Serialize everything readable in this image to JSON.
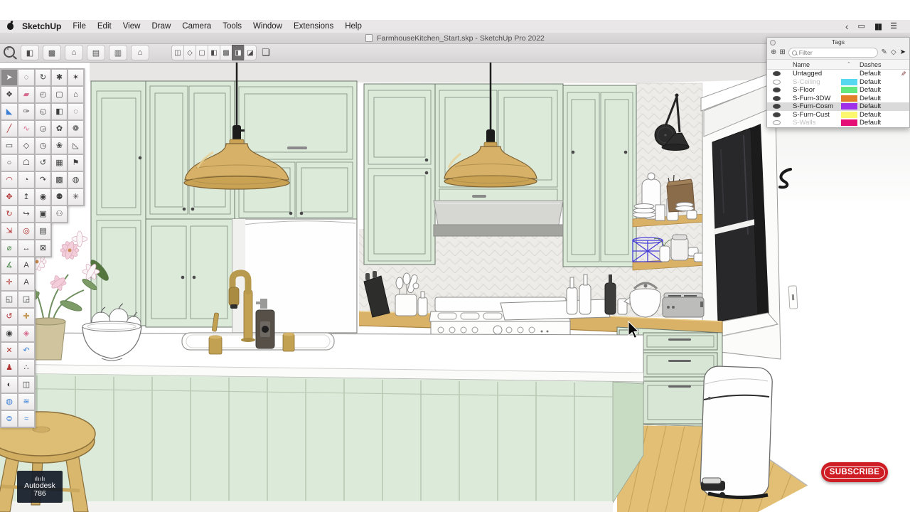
{
  "title_bar": {
    "title": "FarmhouseKitchen_Start.skp - SketchUp Pro 2022"
  },
  "menu_bar": {
    "items": [
      "SketchUp",
      "File",
      "Edit",
      "View",
      "Draw",
      "Camera",
      "Tools",
      "Window",
      "Extensions",
      "Help"
    ],
    "status_icons": [
      {
        "name": "back-chevron-icon",
        "glyph": "‹"
      },
      {
        "name": "display-mirror-icon",
        "glyph": "▭"
      },
      {
        "name": "app-switcher-icon",
        "glyph": "▮▮"
      },
      {
        "name": "list-icon",
        "glyph": "☰"
      }
    ]
  },
  "toolbar": {
    "zoom_tool_name": "zoom-selection",
    "view_buttons": [
      {
        "name": "iso-view",
        "glyph": "◧"
      },
      {
        "name": "textured-view",
        "glyph": "▩"
      },
      {
        "name": "home-view",
        "glyph": "⌂"
      },
      {
        "name": "front-view",
        "glyph": "▤"
      },
      {
        "name": "saved-view",
        "glyph": "▥"
      },
      {
        "name": "outline-view",
        "glyph": "⌂"
      }
    ],
    "style_buttons": [
      {
        "name": "x-ray-style",
        "glyph": "◫"
      },
      {
        "name": "wireframe-style",
        "glyph": "◇"
      },
      {
        "name": "hidden-line-style",
        "glyph": "▢"
      },
      {
        "name": "shaded-style",
        "glyph": "◧"
      },
      {
        "name": "shaded-textures-style",
        "glyph": "▩"
      },
      {
        "name": "sketchy-edges-style",
        "glyph": "◨",
        "selected": true
      },
      {
        "name": "monochrome-style",
        "glyph": "◪"
      }
    ],
    "book_button": {
      "name": "styles-book",
      "glyph": "❏"
    }
  },
  "left_palette": {
    "main": [
      {
        "name": "select",
        "glyph": "➤",
        "selected": true
      },
      {
        "name": "lasso",
        "glyph": "◌"
      },
      {
        "name": "make-component",
        "glyph": "❖"
      },
      {
        "name": "eraser",
        "glyph": "▰",
        "color": "#d66a8e"
      },
      {
        "name": "paint-bucket",
        "glyph": "◣",
        "color": "#3b7fd4"
      },
      {
        "name": "sample-material",
        "glyph": "✑"
      },
      {
        "name": "line",
        "glyph": "╱",
        "color": "#b03030"
      },
      {
        "name": "freehand",
        "glyph": "∿",
        "color": "#d66a8e"
      },
      {
        "name": "rectangle",
        "glyph": "▭"
      },
      {
        "name": "rotated-rectangle",
        "glyph": "◇"
      },
      {
        "name": "circle",
        "glyph": "○"
      },
      {
        "name": "polygon",
        "glyph": "☖"
      },
      {
        "name": "arc",
        "glyph": "◠",
        "color": "#b03030"
      },
      {
        "name": "pie",
        "glyph": "◔"
      },
      {
        "name": "move",
        "glyph": "✥",
        "color": "#b03030"
      },
      {
        "name": "push-pull",
        "glyph": "↥"
      },
      {
        "name": "rotate",
        "glyph": "↻",
        "color": "#b03030"
      },
      {
        "name": "follow-me",
        "glyph": "↪"
      },
      {
        "name": "scale",
        "glyph": "⇲",
        "color": "#b03030"
      },
      {
        "name": "offset",
        "glyph": "◎",
        "color": "#b03030"
      },
      {
        "name": "tape-measure",
        "glyph": "⌀",
        "color": "#3f7f3f"
      },
      {
        "name": "dimension",
        "glyph": "↔"
      },
      {
        "name": "protractor",
        "glyph": "∡",
        "color": "#3f7f3f"
      },
      {
        "name": "text",
        "glyph": "A"
      },
      {
        "name": "axes",
        "glyph": "✛",
        "color": "#b03030"
      },
      {
        "name": "3d-text",
        "glyph": "A"
      },
      {
        "name": "section-plane",
        "glyph": "◱"
      },
      {
        "name": "section-fill",
        "glyph": "◲"
      },
      {
        "name": "orbit",
        "glyph": "↺",
        "color": "#b03030"
      },
      {
        "name": "pan",
        "glyph": "✚",
        "color": "#c59a56"
      },
      {
        "name": "zoom",
        "glyph": "◉"
      },
      {
        "name": "zoom-window",
        "glyph": "◈",
        "color": "#d66a8e"
      },
      {
        "name": "zoom-extents",
        "glyph": "✕",
        "color": "#b03030"
      },
      {
        "name": "previous-view",
        "glyph": "↶",
        "color": "#3b7fd4"
      },
      {
        "name": "position-camera",
        "glyph": "♟",
        "color": "#b03030"
      },
      {
        "name": "walk",
        "glyph": "∴"
      },
      {
        "name": "look-around",
        "glyph": "◐"
      },
      {
        "name": "section-display",
        "glyph": "◫"
      },
      {
        "name": "sandbox-smoove",
        "glyph": "◍",
        "color": "#3b7fd4"
      },
      {
        "name": "sandbox-drape",
        "glyph": "≋",
        "color": "#3b7fd4"
      },
      {
        "name": "sandbox-stamp",
        "glyph": "⊜",
        "color": "#3b7fd4"
      },
      {
        "name": "sandbox-detail",
        "glyph": "≈",
        "color": "#3b7fd4"
      }
    ],
    "aux_a": [
      {
        "name": "rotate-view",
        "glyph": "↻"
      },
      {
        "name": "iso-view-tool",
        "glyph": "◴"
      },
      {
        "name": "top-view-tool",
        "glyph": "◵"
      },
      {
        "name": "front-view-tool",
        "glyph": "◶"
      },
      {
        "name": "back-view-tool",
        "glyph": "◷"
      },
      {
        "name": "left-view-tool",
        "glyph": "↺"
      },
      {
        "name": "right-view-tool",
        "glyph": "↷"
      },
      {
        "name": "camera-eye-tool",
        "glyph": "◉"
      },
      {
        "name": "frame-tool",
        "glyph": "▣"
      },
      {
        "name": "panels-tool",
        "glyph": "▤"
      },
      {
        "name": "lock-tool",
        "glyph": "⊠"
      }
    ],
    "aux_b": [
      {
        "name": "settings-tool",
        "glyph": "✱"
      },
      {
        "name": "box-tool",
        "glyph": "▢"
      },
      {
        "name": "camera-box-tool",
        "glyph": "◧"
      },
      {
        "name": "leaf-tool",
        "glyph": "✿"
      },
      {
        "name": "plant-tool",
        "glyph": "❀"
      },
      {
        "name": "tiles-tool",
        "glyph": "▦"
      },
      {
        "name": "grid-tool",
        "glyph": "▩"
      },
      {
        "name": "figures-tool",
        "glyph": "⚉"
      },
      {
        "name": "figure-pair-tool",
        "glyph": "⚇"
      }
    ],
    "aux_c": [
      {
        "name": "gear-tool",
        "glyph": "✶"
      },
      {
        "name": "roof-tool",
        "glyph": "⌂"
      },
      {
        "name": "ring-tool",
        "glyph": "◌"
      },
      {
        "name": "flower-tool",
        "glyph": "❁"
      },
      {
        "name": "ramp-tool",
        "glyph": "◺"
      },
      {
        "name": "stand-tool",
        "glyph": "⚑"
      },
      {
        "name": "dome-tool",
        "glyph": "◍"
      },
      {
        "name": "sun-tool",
        "glyph": "✳"
      }
    ]
  },
  "tags_panel": {
    "title": "Tags",
    "filter_placeholder": "Filter",
    "columns": [
      "Name",
      "Dashes"
    ],
    "rows": [
      {
        "name": "Untagged",
        "dashes": "Default",
        "visible": true,
        "color": null,
        "active": true,
        "dimmed": false,
        "selected": false
      },
      {
        "name": "S-Ceiling",
        "dashes": "Default",
        "visible": false,
        "color": "#56d9f0",
        "active": false,
        "dimmed": true,
        "selected": false
      },
      {
        "name": "S-Floor",
        "dashes": "Default",
        "visible": true,
        "color": "#62e87e",
        "active": false,
        "dimmed": false,
        "selected": false
      },
      {
        "name": "S-Furn-3DW",
        "dashes": "Default",
        "visible": true,
        "color": "#e2802a",
        "active": false,
        "dimmed": false,
        "selected": false
      },
      {
        "name": "S-Furn-Cosm",
        "dashes": "Default",
        "visible": true,
        "color": "#9f2fe8",
        "active": false,
        "dimmed": false,
        "selected": true
      },
      {
        "name": "S-Furn-Cust",
        "dashes": "Default",
        "visible": true,
        "color": "#fbf76f",
        "active": false,
        "dimmed": false,
        "selected": false
      },
      {
        "name": "S-Walls",
        "dashes": "Default",
        "visible": false,
        "color": "#e50d76",
        "active": false,
        "dimmed": true,
        "selected": false
      }
    ]
  },
  "watermark": {
    "logo_glyph": "ılıılı",
    "brand": "Autodesk",
    "number": "786"
  },
  "subscribe": {
    "label": "SUBSCRIBE"
  },
  "colors": {
    "cabinet_mint": "#dceada",
    "counter_wood": "#d9b267",
    "pendant_brass": "#d7b167",
    "selection_wireframe_blue": "#4a3fd8",
    "subscribe_red": "#ce1d24",
    "menubar_gray": "#e9e7e8"
  }
}
